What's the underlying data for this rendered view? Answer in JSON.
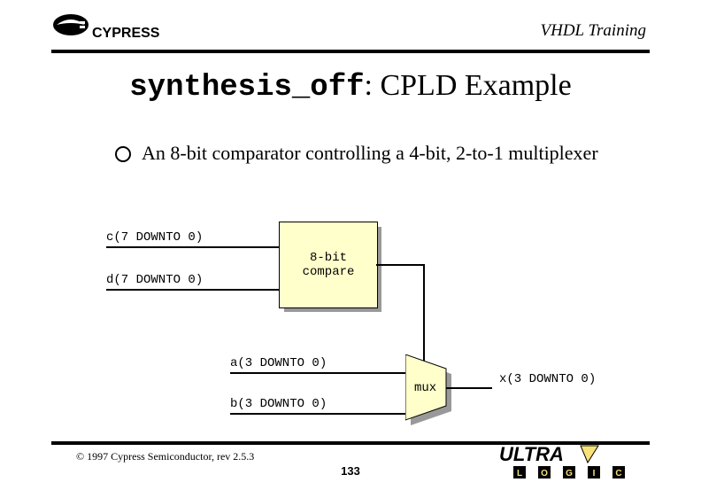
{
  "header": {
    "brand_upper": "CYPRESS",
    "label": "VHDL Training"
  },
  "title": {
    "mono": "synthesis_off",
    "rest": ": CPLD Example"
  },
  "bullet": {
    "text": "An 8-bit comparator controlling a 4-bit, 2-to-1 multiplexer"
  },
  "signals": {
    "c": "c(7 DOWNTO 0)",
    "d": "d(7 DOWNTO 0)",
    "a": "a(3 DOWNTO 0)",
    "b": "b(3 DOWNTO 0)",
    "x": "x(3 DOWNTO 0)"
  },
  "blocks": {
    "compare_line1": "8-bit",
    "compare_line2": "compare",
    "mux": "mux"
  },
  "footer": {
    "copyright": "© 1997 Cypress Semiconductor, rev 2.5.3",
    "page": "133",
    "ultra_text": "ULTRA",
    "ultra_sub": [
      "L",
      "O",
      "G",
      "I",
      "C"
    ]
  }
}
